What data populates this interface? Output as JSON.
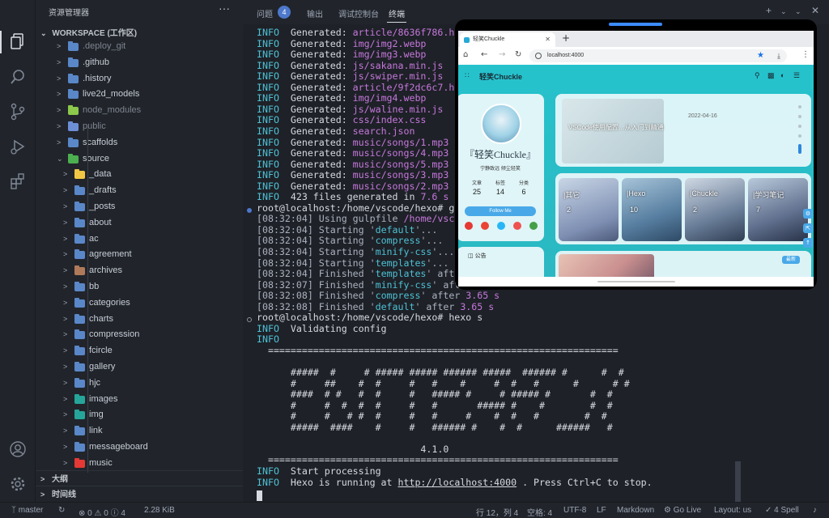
{
  "sidebar": {
    "title": "资源管理器",
    "more": "···",
    "workspace": "WORKSPACE (工作区)",
    "items": [
      {
        "label": ".deploy_git",
        "icon": "folder-icon",
        "color": "#5a87c8",
        "dim": true,
        "level": 1
      },
      {
        "label": ".github",
        "icon": "folder-github-icon",
        "color": "#5a87c8",
        "dim": false,
        "level": 1
      },
      {
        "label": ".history",
        "icon": "folder-icon",
        "color": "#5a87c8",
        "dim": false,
        "level": 1
      },
      {
        "label": "live2d_models",
        "icon": "folder-icon",
        "color": "#5a87c8",
        "dim": false,
        "level": 1
      },
      {
        "label": "node_modules",
        "icon": "folder-node-icon",
        "color": "#8cc84b",
        "dim": true,
        "level": 1
      },
      {
        "label": "public",
        "icon": "folder-public-icon",
        "color": "#6d8fd6",
        "dim": true,
        "level": 1
      },
      {
        "label": "scaffolds",
        "icon": "folder-icon",
        "color": "#5a87c8",
        "dim": false,
        "level": 1
      },
      {
        "label": "source",
        "icon": "folder-open-icon",
        "color": "#4caf50",
        "dim": false,
        "level": 1,
        "open": true
      },
      {
        "label": "_data",
        "icon": "folder-icon",
        "color": "#f2c744",
        "dim": false,
        "level": 2
      },
      {
        "label": "_drafts",
        "icon": "folder-icon",
        "color": "#5a87c8",
        "dim": false,
        "level": 2
      },
      {
        "label": "_posts",
        "icon": "folder-icon",
        "color": "#5a87c8",
        "dim": false,
        "level": 2
      },
      {
        "label": "about",
        "icon": "folder-icon",
        "color": "#5a87c8",
        "dim": false,
        "level": 2
      },
      {
        "label": "ac",
        "icon": "folder-icon",
        "color": "#5a87c8",
        "dim": false,
        "level": 2
      },
      {
        "label": "agreement",
        "icon": "folder-icon",
        "color": "#5a87c8",
        "dim": false,
        "level": 2
      },
      {
        "label": "archives",
        "icon": "folder-icon",
        "color": "#b07a5a",
        "dim": false,
        "level": 2
      },
      {
        "label": "bb",
        "icon": "folder-icon",
        "color": "#5a87c8",
        "dim": false,
        "level": 2
      },
      {
        "label": "categories",
        "icon": "folder-icon",
        "color": "#5a87c8",
        "dim": false,
        "level": 2
      },
      {
        "label": "charts",
        "icon": "folder-icon",
        "color": "#5a87c8",
        "dim": false,
        "level": 2
      },
      {
        "label": "compression",
        "icon": "folder-icon",
        "color": "#5a87c8",
        "dim": false,
        "level": 2
      },
      {
        "label": "fcircle",
        "icon": "folder-icon",
        "color": "#5a87c8",
        "dim": false,
        "level": 2
      },
      {
        "label": "gallery",
        "icon": "folder-icon",
        "color": "#5a87c8",
        "dim": false,
        "level": 2
      },
      {
        "label": "hjc",
        "icon": "folder-icon",
        "color": "#5a87c8",
        "dim": false,
        "level": 2
      },
      {
        "label": "images",
        "icon": "folder-images-icon",
        "color": "#26a69a",
        "dim": false,
        "level": 2
      },
      {
        "label": "img",
        "icon": "folder-images-icon",
        "color": "#26a69a",
        "dim": false,
        "level": 2
      },
      {
        "label": "link",
        "icon": "folder-icon",
        "color": "#5a87c8",
        "dim": false,
        "level": 2
      },
      {
        "label": "messageboard",
        "icon": "folder-icon",
        "color": "#5a87c8",
        "dim": false,
        "level": 2
      },
      {
        "label": "music",
        "icon": "folder-music-icon",
        "color": "#e53935",
        "dim": false,
        "level": 2
      }
    ],
    "outline": "大纲",
    "timeline": "时间线"
  },
  "tabs": {
    "problems": "问题",
    "problems_count": "4",
    "output": "输出",
    "debug": "调试控制台",
    "terminal": "终端",
    "plus": "+",
    "chev": "⌄"
  },
  "terminal": {
    "lines": [
      [
        [
          "INFO",
          "c-info"
        ],
        [
          "  Generated: ",
          "c-white"
        ],
        [
          "article/8636f786.html",
          "c-mag"
        ]
      ],
      [
        [
          "INFO",
          "c-info"
        ],
        [
          "  Generated: ",
          "c-white"
        ],
        [
          "img/img2.webp",
          "c-mag"
        ]
      ],
      [
        [
          "INFO",
          "c-info"
        ],
        [
          "  Generated: ",
          "c-white"
        ],
        [
          "img/img3.webp",
          "c-mag"
        ]
      ],
      [
        [
          "INFO",
          "c-info"
        ],
        [
          "  Generated: ",
          "c-white"
        ],
        [
          "js/sakana.min.js",
          "c-mag"
        ]
      ],
      [
        [
          "INFO",
          "c-info"
        ],
        [
          "  Generated: ",
          "c-white"
        ],
        [
          "js/swiper.min.js",
          "c-mag"
        ]
      ],
      [
        [
          "INFO",
          "c-info"
        ],
        [
          "  Generated: ",
          "c-white"
        ],
        [
          "article/9f2dc6c7.html",
          "c-mag"
        ]
      ],
      [
        [
          "INFO",
          "c-info"
        ],
        [
          "  Generated: ",
          "c-white"
        ],
        [
          "img/img4.webp",
          "c-mag"
        ]
      ],
      [
        [
          "INFO",
          "c-info"
        ],
        [
          "  Generated: ",
          "c-white"
        ],
        [
          "js/waline.min.js",
          "c-mag"
        ]
      ],
      [
        [
          "INFO",
          "c-info"
        ],
        [
          "  Generated: ",
          "c-white"
        ],
        [
          "css/index.css",
          "c-mag"
        ]
      ],
      [
        [
          "INFO",
          "c-info"
        ],
        [
          "  Generated: ",
          "c-white"
        ],
        [
          "search.json",
          "c-mag"
        ]
      ],
      [
        [
          "INFO",
          "c-info"
        ],
        [
          "  Generated: ",
          "c-white"
        ],
        [
          "music/songs/1.mp3",
          "c-mag"
        ]
      ],
      [
        [
          "INFO",
          "c-info"
        ],
        [
          "  Generated: ",
          "c-white"
        ],
        [
          "music/songs/4.mp3",
          "c-mag"
        ]
      ],
      [
        [
          "INFO",
          "c-info"
        ],
        [
          "  Generated: ",
          "c-white"
        ],
        [
          "music/songs/5.mp3",
          "c-mag"
        ]
      ],
      [
        [
          "INFO",
          "c-info"
        ],
        [
          "  Generated: ",
          "c-white"
        ],
        [
          "music/songs/3.mp3",
          "c-mag"
        ]
      ],
      [
        [
          "INFO",
          "c-info"
        ],
        [
          "  Generated: ",
          "c-white"
        ],
        [
          "music/songs/2.mp3",
          "c-mag"
        ]
      ],
      [
        [
          "INFO",
          "c-info"
        ],
        [
          "  423 files generated in ",
          "c-white"
        ],
        [
          "7.6 s",
          "c-mag"
        ]
      ],
      [
        [
          "root@localhost:/home/vscode/hexo# gulp",
          "c-white"
        ]
      ],
      [
        [
          "[",
          "c-gray"
        ],
        [
          "08:32:04",
          "c-gray"
        ],
        [
          "] Using gulpfile ",
          "c-gray"
        ],
        [
          "/home/vscode",
          "c-mag"
        ]
      ],
      [
        [
          "[",
          "c-gray"
        ],
        [
          "08:32:04",
          "c-gray"
        ],
        [
          "] Starting '",
          "c-gray"
        ],
        [
          "default",
          "c-str"
        ],
        [
          "'...",
          "c-gray"
        ]
      ],
      [
        [
          "[",
          "c-gray"
        ],
        [
          "08:32:04",
          "c-gray"
        ],
        [
          "] Starting '",
          "c-gray"
        ],
        [
          "compress",
          "c-str"
        ],
        [
          "'...",
          "c-gray"
        ]
      ],
      [
        [
          "[",
          "c-gray"
        ],
        [
          "08:32:04",
          "c-gray"
        ],
        [
          "] Starting '",
          "c-gray"
        ],
        [
          "minify-css",
          "c-str"
        ],
        [
          "'...",
          "c-gray"
        ]
      ],
      [
        [
          "[",
          "c-gray"
        ],
        [
          "08:32:04",
          "c-gray"
        ],
        [
          "] Starting '",
          "c-gray"
        ],
        [
          "templates",
          "c-str"
        ],
        [
          "'...",
          "c-gray"
        ]
      ],
      [
        [
          "[",
          "c-gray"
        ],
        [
          "08:32:04",
          "c-gray"
        ],
        [
          "] Finished '",
          "c-gray"
        ],
        [
          "templates",
          "c-str"
        ],
        [
          "' after",
          "c-gray"
        ]
      ],
      [
        [
          "[",
          "c-gray"
        ],
        [
          "08:32:07",
          "c-gray"
        ],
        [
          "] Finished '",
          "c-gray"
        ],
        [
          "minify-css",
          "c-str"
        ],
        [
          "' after",
          "c-gray"
        ]
      ],
      [
        [
          "[",
          "c-gray"
        ],
        [
          "08:32:08",
          "c-gray"
        ],
        [
          "] Finished '",
          "c-gray"
        ],
        [
          "compress",
          "c-str"
        ],
        [
          "' after ",
          "c-gray"
        ],
        [
          "3.65 s",
          "c-mag"
        ]
      ],
      [
        [
          "[",
          "c-gray"
        ],
        [
          "08:32:08",
          "c-gray"
        ],
        [
          "] Finished '",
          "c-gray"
        ],
        [
          "default",
          "c-str"
        ],
        [
          "' after ",
          "c-gray"
        ],
        [
          "3.65 s",
          "c-mag"
        ]
      ],
      [
        [
          "root@localhost:/home/vscode/hexo# hexo s",
          "c-white"
        ]
      ],
      [
        [
          "INFO",
          "c-info"
        ],
        [
          "  Validating config",
          "c-white"
        ]
      ],
      [
        [
          "INFO",
          "c-info"
        ]
      ],
      [
        [
          "  ==============================================================",
          "c-white"
        ]
      ],
      [
        [
          "",
          "c-white"
        ]
      ],
      [
        [
          "      #####  #     # ##### ##### ###### #####  ###### #      #  #",
          "c-white"
        ]
      ],
      [
        [
          "      #     ##    #  #     #   #    #     #  #   #      #      # #",
          "c-white"
        ]
      ],
      [
        [
          "      ####  # #   #  #     #   ##### #     # ##### #       #  #",
          "c-white"
        ]
      ],
      [
        [
          "      #     #  #  #  #     #   #       ##### #    #        #  #",
          "c-white"
        ]
      ],
      [
        [
          "      #     #   # #  #     #   #     #    #  #   #        #  #",
          "c-white"
        ]
      ],
      [
        [
          "      #####  ####    #     #   ###### #    #  #      ######   #",
          "c-white"
        ]
      ],
      [
        [
          "",
          "c-white"
        ]
      ],
      [
        [
          "                             4.1.0",
          "c-white"
        ]
      ],
      [
        [
          "  ==============================================================",
          "c-white"
        ]
      ],
      [
        [
          "INFO",
          "c-info"
        ],
        [
          "  Start processing",
          "c-white"
        ]
      ],
      [
        [
          "INFO",
          "c-info"
        ],
        [
          "  Hexo is running at ",
          "c-white"
        ],
        [
          "http://localhost:4000",
          "c-white u"
        ],
        [
          " . Press Ctrl+C to stop.",
          "c-white"
        ]
      ]
    ]
  },
  "status": {
    "branch": "master",
    "problems": "⊗ 0 ⚠ 0 ⓘ 4",
    "size": "2.28 KiB",
    "position": "行 12，列 4",
    "spaces": "空格: 4",
    "encoding": "UTF-8",
    "eol": "LF",
    "language": "Markdown",
    "golive": "Go Live",
    "layout": "Layout: us",
    "spell": "4 Spell"
  },
  "browser": {
    "tab_title": "轻笑Chuckle",
    "url": "localhost:4000",
    "site_name": "轻笑Chuckle",
    "profile_name": "『轻笑Chuckle』",
    "profile_desc": "宁静致远 倾尘轻笑",
    "stats": [
      {
        "k": "文章",
        "v": "25"
      },
      {
        "k": "标签",
        "v": "14"
      },
      {
        "k": "分类",
        "v": "6"
      }
    ],
    "follow": "Follow Me",
    "notice": "公告",
    "hero_date": "2022-04-16",
    "hero_title": "VSCode使用配置…从入门到精通",
    "categories": [
      {
        "label": "|其它",
        "count": "2"
      },
      {
        "label": "|Hexo",
        "count": "10"
      },
      {
        "label": "|Chuckle",
        "count": "2"
      },
      {
        "label": "|学习笔记",
        "count": "7"
      }
    ],
    "new_badge": "最新"
  }
}
